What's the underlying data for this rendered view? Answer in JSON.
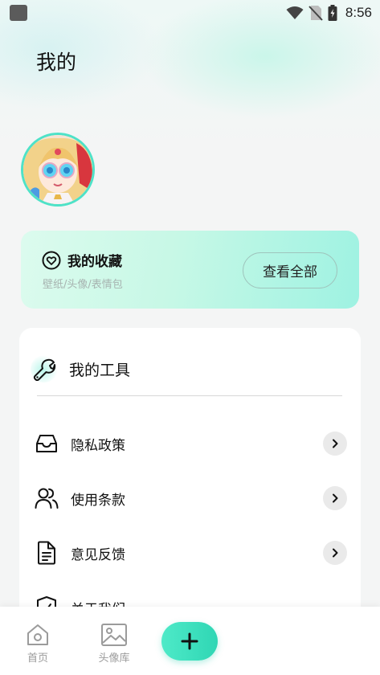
{
  "status_bar": {
    "time": "8:56"
  },
  "page": {
    "title": "我的"
  },
  "favorites": {
    "title": "我的收藏",
    "subtitle": "壁纸/头像/表情包",
    "button_label": "查看全部"
  },
  "tools": {
    "title": "我的工具",
    "items": [
      {
        "label": "隐私政策",
        "icon": "inbox-tray-icon"
      },
      {
        "label": "使用条款",
        "icon": "users-icon"
      },
      {
        "label": "意见反馈",
        "icon": "document-icon"
      },
      {
        "label": "关于我们",
        "icon": "shield-icon"
      }
    ]
  },
  "bottom_nav": {
    "items": [
      {
        "label": "首页",
        "icon": "home-icon"
      },
      {
        "label": "头像库",
        "icon": "image-icon"
      }
    ],
    "add_icon": "plus-icon"
  },
  "colors": {
    "accent": "#4eeac8",
    "card_gradient_end": "#9ef2e2",
    "text_muted": "#9b9b9b"
  }
}
